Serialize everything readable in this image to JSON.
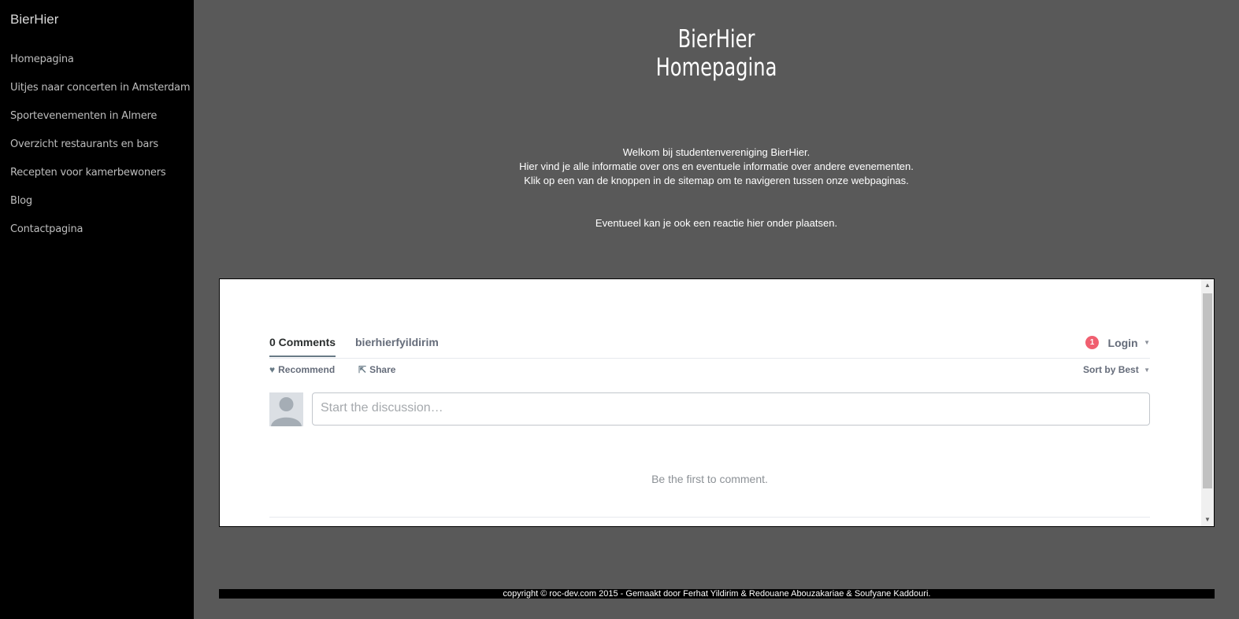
{
  "sidebar": {
    "brand": "BierHier",
    "items": [
      {
        "label": "Homepagina"
      },
      {
        "label": "Uitjes naar concerten in Amsterdam"
      },
      {
        "label": "Sportevenementen in Almere"
      },
      {
        "label": "Overzicht restaurants en bars"
      },
      {
        "label": "Recepten voor kamerbewoners"
      },
      {
        "label": "Blog"
      },
      {
        "label": "Contactpagina"
      }
    ]
  },
  "header": {
    "title_line1": "BierHier",
    "title_line2": "Homepagina"
  },
  "intro": {
    "line1": "Welkom bij studentenvereniging BierHier.",
    "line2": "Hier vind je alle informatie over ons en eventuele informatie over andere evenementen.",
    "line3": "Klik op een van de knoppen in de sitemap om te navigeren tussen onze webpaginas.",
    "line4": "Eventueel kan je ook een reactie hier onder plaatsen."
  },
  "comments": {
    "tab_comments": "0 Comments",
    "tab_community": "bierhierfyildirim",
    "notification_count": "1",
    "login_label": "Login",
    "recommend_label": "Recommend",
    "share_label": "Share",
    "sort_label": "Sort by Best",
    "input_placeholder": "Start the discussion…",
    "empty_text": "Be the first to comment."
  },
  "footer": {
    "text": "copyright © roc-dev.com 2015 - Gemaakt door Ferhat Yildirim & Redouane Abouzakariae & Soufyane Kaddouri."
  },
  "colors": {
    "background": "#595959",
    "sidebar": "#000000",
    "badge": "#f05f70"
  },
  "icons": [
    "heart-icon",
    "share-icon",
    "chevron-down-icon",
    "avatar-placeholder-icon",
    "scroll-up-icon",
    "scroll-down-icon"
  ]
}
